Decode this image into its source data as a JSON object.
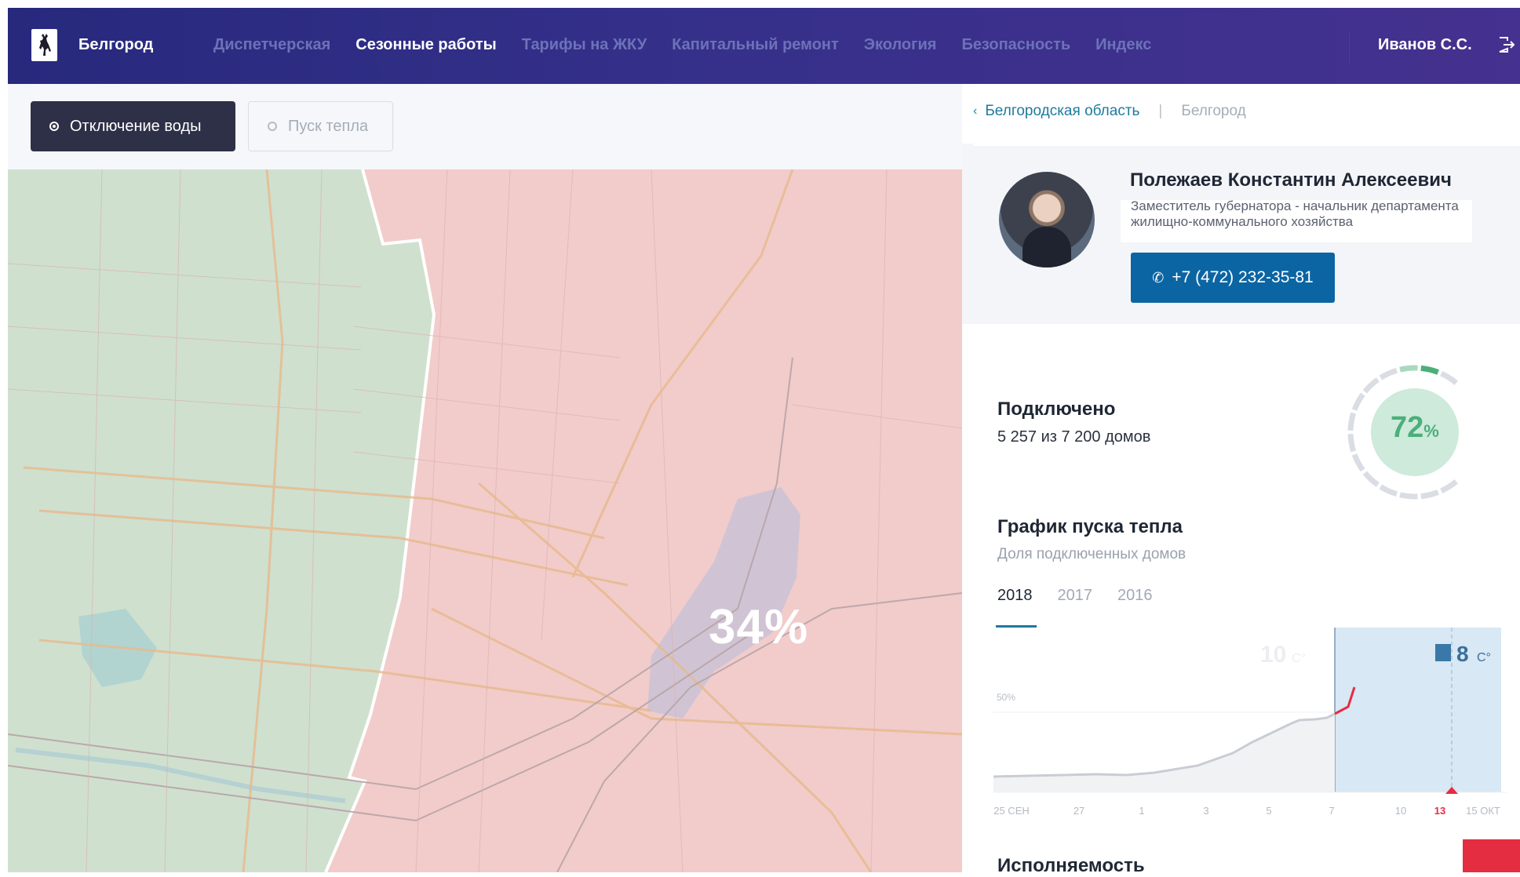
{
  "header": {
    "city": "Белгород",
    "nav": [
      {
        "label": "Диспетчерская",
        "active": false
      },
      {
        "label": "Сезонные работы",
        "active": true
      },
      {
        "label": "Тарифы на ЖКУ",
        "active": false
      },
      {
        "label": "Капитальный ремонт",
        "active": false
      },
      {
        "label": "Экология",
        "active": false
      },
      {
        "label": "Безопасность",
        "active": false
      },
      {
        "label": "Индекс",
        "active": false
      }
    ],
    "user": "Иванов С.С."
  },
  "controls": {
    "water_off": "Отключение воды",
    "heat_start": "Пуск тепла"
  },
  "map": {
    "percent": "34%",
    "zone_colors": {
      "green": "#cfe1cf",
      "red": "#f2c9c9"
    }
  },
  "breadcrumb": {
    "region": "Белгородская область",
    "city": "Белгород"
  },
  "official": {
    "name": "Полежаев Константин Алексеевич",
    "role": "Заместитель губернатора - начальник департамента жилищно-коммунального хозяйства",
    "phone": "+7 (472) 232-35-81"
  },
  "connected": {
    "title": "Подключено",
    "subtitle": "5 257 из 7 200 домов",
    "percent": 72,
    "percent_num": "72",
    "percent_sign": "%"
  },
  "chart_section": {
    "title": "График пуска тепла",
    "subtitle": "Доля подключенных домов",
    "tabs": [
      "2018",
      "2017",
      "2016"
    ],
    "active_tab": "2018"
  },
  "chart_data": {
    "type": "line",
    "x_labels": [
      "25 СЕН",
      "27",
      "1",
      "3",
      "5",
      "7",
      "10",
      "13",
      "15 ОКТ"
    ],
    "highlight_label": "13",
    "y_label_50": "50%",
    "temp_past": "10",
    "temp_current": "8",
    "temp_unit": "C°",
    "colors": {
      "line": "#c9cdd3",
      "highlight": "#d8e8f4",
      "red": "#e42d41",
      "marker": "#3a78a8"
    }
  },
  "next_section": {
    "title": "Исполняемость"
  }
}
